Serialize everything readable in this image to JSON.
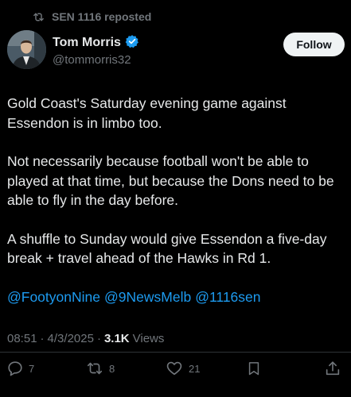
{
  "repost": {
    "label": "SEN 1116 reposted",
    "icon": "repost-icon"
  },
  "author": {
    "display_name": "Tom Morris",
    "handle": "@tommorris32",
    "verified": true,
    "verified_color": "#1d9bf0"
  },
  "follow_button": {
    "label": "Follow"
  },
  "tweet": {
    "paragraphs": [
      "Gold Coast's Saturday evening game against Essendon is in limbo too.",
      "Not necessarily because football won't be able to played at that time, but because the Dons need to be able to fly in the day before.",
      "A shuffle to Sunday would give Essendon a five-day break + travel ahead of the Hawks in Rd 1."
    ],
    "mentions": [
      "@FootyonNine",
      "@9NewsMelb",
      "@1116sen"
    ]
  },
  "meta": {
    "time": "08:51",
    "separator": "·",
    "date": "4/3/2025",
    "separator2": "·",
    "views_count": "3.1K",
    "views_label": "Views"
  },
  "actions": {
    "replies": "7",
    "reposts": "8",
    "likes": "21"
  },
  "colors": {
    "background": "#000000",
    "text": "#e7e9ea",
    "secondary": "#71767b",
    "link": "#1d9bf0",
    "divider": "#2f3336"
  }
}
